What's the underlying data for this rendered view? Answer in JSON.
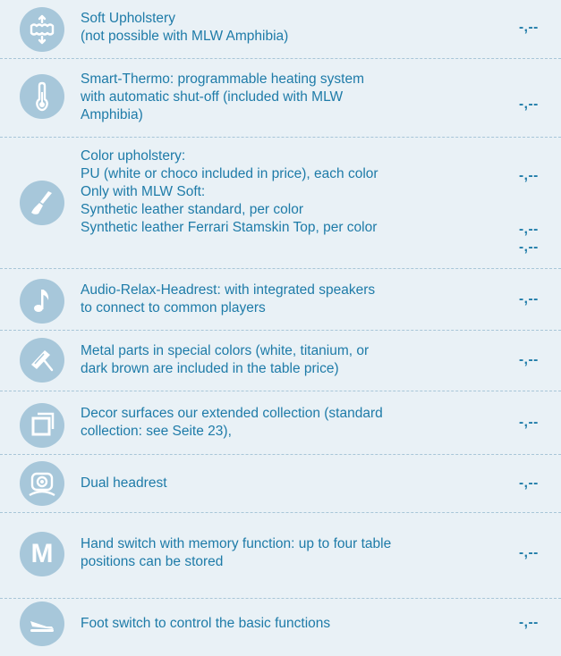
{
  "items": [
    {
      "icon": "upholstery-arrows-icon",
      "lines": [
        "Soft Upholstery",
        "(not possible with MLW Amphibia)"
      ],
      "price": "-,--"
    },
    {
      "icon": "thermometer-icon",
      "lines": [
        "Smart-Thermo: programmable heating system",
        "with automatic shut-off (included with MLW",
        "Amphibia)"
      ],
      "price": "-,--"
    },
    {
      "icon": "paint-brush-icon",
      "lines": [
        "Color upholstery:",
        "PU (white or choco included in price), each color",
        "Only with MLW Soft:",
        "Synthetic leather standard, per color",
        "Synthetic leather Ferrari Stamskin Top, per color"
      ],
      "prices": [
        "-,--",
        "-,--",
        "-,--"
      ]
    },
    {
      "icon": "music-note-icon",
      "lines": [
        "Audio-Relax-Headrest: with integrated speakers",
        "to connect to common players"
      ],
      "price": "-,--"
    },
    {
      "icon": "paint-roller-icon",
      "lines": [
        "Metal parts in special colors (white, titanium, or",
        "dark brown are included in the table price)"
      ],
      "price": "-,--"
    },
    {
      "icon": "decor-square-icon",
      "lines": [
        "Decor surfaces  our extended collection (standard",
        "collection: see Seite 23),"
      ],
      "price": "-,--"
    },
    {
      "icon": "headrest-icon",
      "lines": [
        "Dual headrest"
      ],
      "price": "-,--"
    },
    {
      "icon": "memory-m-icon",
      "lines": [
        "Hand switch with memory function: up to four table",
        "positions can be stored"
      ],
      "price": "-,--"
    },
    {
      "icon": "foot-switch-icon",
      "lines": [
        "Foot switch to control the basic functions"
      ],
      "price": "-,--"
    }
  ],
  "memory_letter": "M",
  "colors": {
    "text": "#1e7ba8",
    "icon_bg": "#a7c7da",
    "background": "#e9f1f6"
  }
}
